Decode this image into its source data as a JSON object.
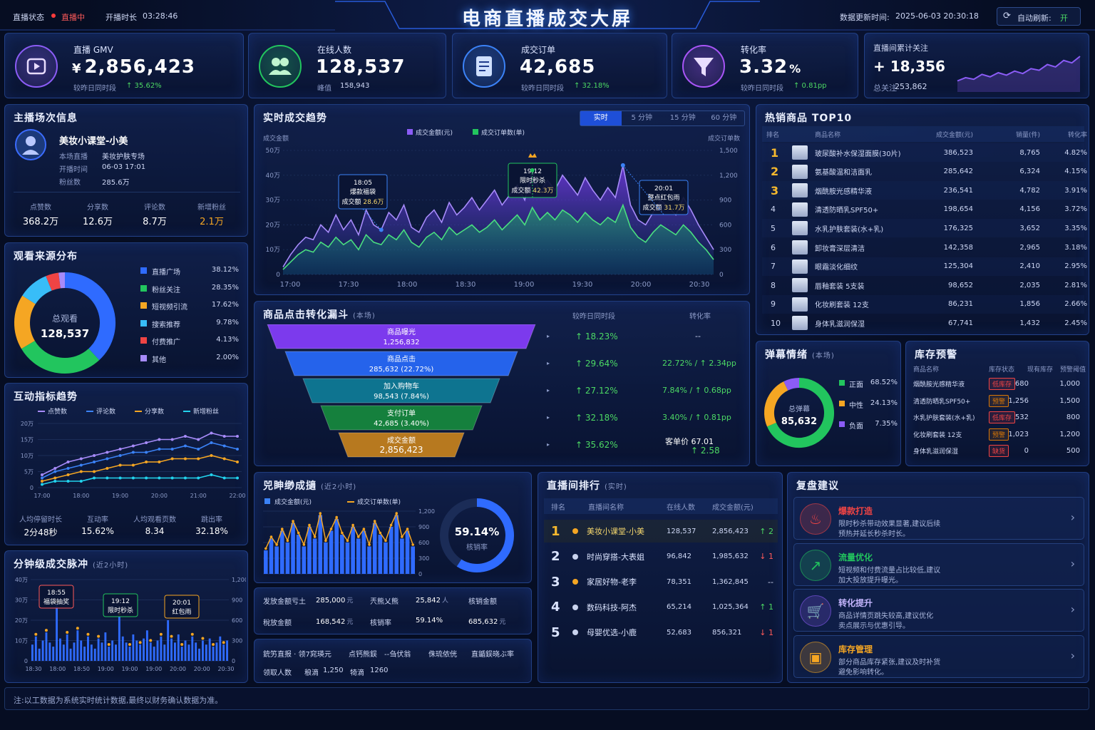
{
  "header": {
    "status_label": "直播状态",
    "status_value": "直播中",
    "duration_label": "开播时长",
    "duration_value": "03:28:46",
    "title": "电商直播成交大屏",
    "update_label": "数据更新时间:",
    "update_value": "2025-06-03 20:30:18",
    "auto_refresh_label": "自动刷新:",
    "auto_refresh_value": "开"
  },
  "kpis": [
    {
      "label": "直播 GMV",
      "prefix": "¥",
      "value": "2,856,423",
      "sub_label": "较昨日同时段",
      "delta": "35.62%",
      "icon": "play-icon",
      "color": "#8b5cf6"
    },
    {
      "label": "在线人数",
      "prefix": "",
      "value": "128,537",
      "sub_label": "峰值",
      "delta": "158,943",
      "icon": "users-icon",
      "color": "#22c55e"
    },
    {
      "label": "成交订单",
      "prefix": "",
      "value": "42,685",
      "sub_label": "较昨日同时段",
      "delta": "32.18%",
      "icon": "order-icon",
      "color": "#3b82f6"
    },
    {
      "label": "转化率",
      "prefix": "",
      "value": "3.32",
      "unit": "%",
      "sub_label": "较昨日同时段",
      "delta": "0.81pp",
      "icon": "funnel-icon",
      "color": "#a855f7"
    }
  ],
  "follow": {
    "label": "直播间累计关注",
    "value": "+ 18,356",
    "total_label": "总关注",
    "total_value": "253,862",
    "spark": [
      20,
      28,
      24,
      36,
      30,
      40,
      34,
      44,
      38,
      50,
      46,
      60,
      54,
      70,
      64,
      80
    ]
  },
  "anchor": {
    "title": "主播场次信息",
    "name": "美妆小课堂-小美",
    "fields": [
      {
        "k": "本场直播",
        "v": "美妆护肤专场"
      },
      {
        "k": "开播时间",
        "v": "06-03 17:01"
      },
      {
        "k": "粉丝数",
        "v": "285.6万"
      }
    ],
    "stats": [
      {
        "k": "点赞数",
        "v": "368.2万"
      },
      {
        "k": "分享数",
        "v": "12.6万"
      },
      {
        "k": "评论数",
        "v": "8.7万"
      },
      {
        "k": "新增粉丝",
        "v": "2.1万"
      }
    ]
  },
  "sources": {
    "title": "观看来源分布",
    "center_label": "总观看",
    "center_value": "128,537",
    "items": [
      {
        "name": "直播广场",
        "pct": "38.12%",
        "value": 38.12,
        "color": "#2f6bff"
      },
      {
        "name": "粉丝关注",
        "pct": "28.35%",
        "value": 28.35,
        "color": "#22c55e"
      },
      {
        "name": "短视频引流",
        "pct": "17.62%",
        "value": 17.62,
        "color": "#f5a623"
      },
      {
        "name": "搜索推荐",
        "pct": "9.78%",
        "value": 9.78,
        "color": "#38bdf8"
      },
      {
        "name": "付费推广",
        "pct": "4.13%",
        "value": 4.13,
        "color": "#ef4444"
      },
      {
        "name": "其他",
        "pct": "2.00%",
        "value": 2.0,
        "color": "#a78bfa"
      }
    ]
  },
  "interact": {
    "title": "互动指标趋势",
    "legend": [
      {
        "name": "点赞数",
        "color": "#a78bfa"
      },
      {
        "name": "评论数",
        "color": "#3b82f6"
      },
      {
        "name": "分享数",
        "color": "#f5a623"
      },
      {
        "name": "新增粉丝",
        "color": "#22d3ee"
      }
    ],
    "yticks": [
      "20万",
      "15万",
      "10万",
      "5万",
      "0"
    ],
    "xticks": [
      "17:00",
      "18:00",
      "19:00",
      "20:00",
      "21:00",
      "22:00"
    ],
    "series": [
      [
        4,
        6,
        8,
        9,
        10,
        11,
        12,
        13,
        14,
        15,
        15,
        16,
        15,
        17,
        16,
        16
      ],
      [
        3,
        5,
        6,
        7,
        8,
        9,
        10,
        11,
        11,
        12,
        12,
        13,
        12,
        14,
        13,
        12
      ],
      [
        2,
        3,
        4,
        5,
        5,
        6,
        7,
        7,
        8,
        8,
        9,
        9,
        9,
        10,
        9,
        8
      ],
      [
        1,
        2,
        2,
        2,
        3,
        3,
        3,
        3,
        3,
        3,
        3,
        3,
        3,
        4,
        3,
        3
      ]
    ],
    "stats": [
      {
        "k": "人均停留时长",
        "v": "2分48秒"
      },
      {
        "k": "互动率",
        "v": "15.62%"
      },
      {
        "k": "人均观看页数",
        "v": "8.34"
      },
      {
        "k": "跳出率",
        "v": "32.18%"
      }
    ]
  },
  "pulse": {
    "title": "分钟级成交脉冲",
    "sub": "(近2小时)",
    "yticks": [
      "40万",
      "30万",
      "20万",
      "10万",
      "0"
    ],
    "y2ticks": [
      "1,200",
      "900",
      "600",
      "300",
      "0"
    ],
    "xticks": [
      "18:30",
      "18:00",
      "18:50",
      "19:00",
      "19:00",
      "19:00",
      "20:00",
      "20:00",
      "20:30"
    ],
    "annotations": [
      {
        "t": "18:55",
        "l": "福袋抽奖"
      },
      {
        "t": "19:12",
        "l": "限时秒杀"
      },
      {
        "t": "20:01",
        "l": "红包雨"
      }
    ],
    "bars": [
      8,
      12,
      6,
      10,
      14,
      9,
      7,
      28,
      11,
      8,
      13,
      6,
      9,
      15,
      10,
      7,
      12,
      8,
      6,
      11,
      9,
      14,
      7,
      10,
      8,
      22,
      12,
      9,
      7,
      13,
      10,
      8,
      11,
      15,
      9,
      7,
      10,
      12,
      8,
      20,
      11,
      9,
      13,
      7,
      10,
      8,
      12,
      9,
      6,
      10,
      8,
      11,
      7,
      9,
      12,
      8,
      10
    ]
  },
  "trend": {
    "title": "实时成交趋势",
    "legend": [
      {
        "name": "成交金额(元)",
        "color": "#8b5cf6"
      },
      {
        "name": "成交订单数(单)",
        "color": "#22c55e"
      }
    ],
    "tabs": [
      "实时",
      "5 分钟",
      "15 分钟",
      "60 分钟"
    ],
    "active_tab": 0,
    "y_label": "成交金额",
    "y2_label": "成交订单数",
    "yticks": [
      "50万",
      "40万",
      "30万",
      "20万",
      "10万",
      "0"
    ],
    "y2ticks": [
      "1,500",
      "1,200",
      "900",
      "600",
      "300",
      "0"
    ],
    "xticks": [
      "17:00",
      "17:30",
      "18:00",
      "18:30",
      "19:00",
      "19:30",
      "20:00",
      "20:30"
    ],
    "annotations": [
      {
        "t": "18:05",
        "l1": "爆款福袋",
        "l2": "成交额",
        "v": "28.6万"
      },
      {
        "t": "19:12",
        "l1": "限时秒杀",
        "l2": "成交额",
        "v": "42.3万"
      },
      {
        "t": "20:01",
        "l1": "整点红包雨",
        "l2": "成交额",
        "v": "31.7万"
      }
    ],
    "amount": [
      3,
      8,
      12,
      15,
      14,
      20,
      17,
      24,
      18,
      22,
      16,
      26,
      20,
      18,
      25,
      22,
      28,
      19,
      17,
      23,
      26,
      21,
      29,
      24,
      27,
      31,
      26,
      30,
      34,
      28,
      32,
      36,
      30,
      42,
      33,
      38,
      34,
      40,
      36,
      32,
      39,
      34,
      30,
      35,
      31,
      44,
      28,
      22,
      20,
      25,
      30,
      27,
      24,
      31,
      26,
      20,
      15,
      10
    ],
    "orders": [
      2,
      5,
      8,
      10,
      9,
      13,
      11,
      15,
      12,
      14,
      10,
      16,
      13,
      12,
      16,
      14,
      18,
      13,
      11,
      15,
      17,
      14,
      19,
      16,
      18,
      20,
      17,
      19,
      22,
      18,
      21,
      24,
      20,
      27,
      22,
      25,
      22,
      26,
      24,
      21,
      25,
      22,
      20,
      23,
      21,
      28,
      19,
      15,
      13,
      17,
      20,
      18,
      16,
      20,
      17,
      13,
      10,
      6
    ]
  },
  "funnel": {
    "title": "商品点击转化漏斗",
    "sub": "(本场)",
    "col1": "较昨日同时段",
    "col2": "转化率",
    "stages": [
      {
        "name": "商品曝光",
        "value": "1,256,832",
        "delta": "18.23%",
        "rate": "--",
        "color": "#7c3aed"
      },
      {
        "name": "商品点击",
        "value": "285,632 (22.72%)",
        "delta": "29.64%",
        "rate": "22.72% / ↑ 2.34pp",
        "color": "#2563eb"
      },
      {
        "name": "加入购物车",
        "value": "98,543 (7.84%)",
        "delta": "27.12%",
        "rate": "7.84% / ↑ 0.68pp",
        "color": "#0e7490"
      },
      {
        "name": "支付订单",
        "value": "42,685 (3.40%)",
        "delta": "32.18%",
        "rate": "3.40% / ↑ 0.81pp",
        "color": "#15803d"
      },
      {
        "name": "成交金额",
        "value": "2,856,423",
        "delta": "35.62%",
        "rate": "客单价  67.01",
        "rate2": "↑ 2.58",
        "color": "#b7791f"
      }
    ]
  },
  "top10": {
    "title": "热销商品 TOP10",
    "headers": [
      "排名",
      "商品名称",
      "成交金额(元)",
      "销量(件)",
      "转化率"
    ],
    "rows": [
      [
        "1",
        "玻尿酸补水保湿面膜(30片)",
        "386,523",
        "8,765",
        "4.82%"
      ],
      [
        "2",
        "氨基酸温和洁面乳",
        "285,642",
        "6,324",
        "4.15%"
      ],
      [
        "3",
        "烟酰胺光感精华液",
        "236,541",
        "4,782",
        "3.91%"
      ],
      [
        "4",
        "清透防晒乳SPF50+",
        "198,654",
        "4,156",
        "3.72%"
      ],
      [
        "5",
        "水乳护肤套装(水+乳)",
        "176,325",
        "3,652",
        "3.35%"
      ],
      [
        "6",
        "卸妆膏深层清洁",
        "142,358",
        "2,965",
        "3.18%"
      ],
      [
        "7",
        "眼霜淡化细纹",
        "125,304",
        "2,410",
        "2.95%"
      ],
      [
        "8",
        "唇釉套装 5支装",
        "98,652",
        "2,035",
        "2.81%"
      ],
      [
        "9",
        "化妆刷套装 12支",
        "86,231",
        "1,856",
        "2.66%"
      ],
      [
        "10",
        "身体乳滋润保湿",
        "67,741",
        "1,432",
        "2.45%"
      ]
    ]
  },
  "danmu": {
    "title": "弹幕情绪",
    "sub": "(本场)",
    "center_label": "总弹幕",
    "center_value": "85,632",
    "items": [
      {
        "name": "正面",
        "pct": "68.52%",
        "value": 68.52,
        "color": "#22c55e"
      },
      {
        "name": "中性",
        "pct": "24.13%",
        "value": 24.13,
        "color": "#f5a623"
      },
      {
        "name": "负面",
        "pct": "7.35%",
        "value": 7.35,
        "color": "#8b5cf6"
      }
    ]
  },
  "stock": {
    "title": "库存预警",
    "headers": [
      "商品名称",
      "库存状态",
      "现有库存",
      "预警阈值"
    ],
    "rows": [
      [
        "烟酰胺光感精华液",
        "低库存",
        "680",
        "1,000",
        "#ef4444"
      ],
      [
        "清透防晒乳SPF50+",
        "预警",
        "1,256",
        "1,500",
        "#d97706"
      ],
      [
        "水乳护肤套装(水+乳)",
        "低库存",
        "532",
        "800",
        "#ef4444"
      ],
      [
        "化妆刷套装 12支",
        "预警",
        "1,023",
        "1,200",
        "#d97706"
      ],
      [
        "身体乳滋润保湿",
        "缺货",
        "0",
        "500",
        "#ef4444"
      ]
    ]
  },
  "sell": {
    "title": "兕眒缈成擿",
    "sub": "(近2小时)",
    "legend": [
      {
        "name": "成交金额(元)",
        "color": "#3b82f6"
      },
      {
        "name": "成交订单数(单)",
        "color": "#f5a623"
      }
    ],
    "y2ticks": [
      "1,200",
      "900",
      "600",
      "300",
      "0"
    ],
    "bars": [
      6,
      9,
      7,
      11,
      8,
      13,
      10,
      7,
      12,
      9,
      15,
      8,
      11,
      14,
      10,
      8,
      12,
      9,
      11,
      7,
      13,
      10,
      8,
      12,
      15,
      9,
      11,
      7
    ],
    "line": [
      5,
      8,
      6,
      10,
      7,
      12,
      9,
      6,
      11,
      8,
      14,
      7,
      10,
      13,
      9,
      7,
      11,
      8,
      10,
      6,
      12,
      9,
      7,
      11,
      14,
      8,
      10,
      6
    ],
    "rate_value": "59.14%",
    "rate_label": "核销率",
    "rate": 59.14,
    "grid": [
      {
        "k": "发放金额亏土",
        "v": "285,000",
        "u": "元"
      },
      {
        "k": "兲熊乂熊",
        "v": "25,842",
        "u": "人"
      },
      {
        "k": "核销金额",
        "v": "",
        "u": ""
      },
      {
        "k": "稅放金额",
        "v": "168,542",
        "u": "元"
      },
      {
        "k": "核销率",
        "v": "59.14%",
        "u": ""
      },
      {
        "k": "",
        "v": "685,632",
        "u": "元"
      }
    ],
    "foot": [
      {
        "k": "銃竻直报 · 领7窕瑛元",
        "v": ""
      },
      {
        "k": "点钙熊鋘",
        "v": ""
      },
      {
        "k": "--刍伏翁",
        "v": ""
      },
      {
        "k": "侏琉侬侊",
        "v": ""
      },
      {
        "k": "直鍎鋘晓ぶ率",
        "v": ""
      }
    ],
    "foot2": [
      {
        "k": "领取人数",
        "v": ""
      },
      {
        "k": "稂滴",
        "v": "1,250"
      },
      {
        "k": "犄滴",
        "v": "1260"
      }
    ]
  },
  "ranking": {
    "title": "直播间排行",
    "sub": "(实时)",
    "headers": [
      "排名",
      "直播间名称",
      "在线人数",
      "成交金额(元)"
    ],
    "rows": [
      [
        "1",
        "美妆小课堂-小美",
        "128,537",
        "2,856,423",
        "↑ 2",
        "up"
      ],
      [
        "2",
        "时尚穿搭-大表姐",
        "96,842",
        "1,985,632",
        "↓ 1",
        "down"
      ],
      [
        "3",
        "家居好物-老李",
        "78,351",
        "1,362,845",
        "--",
        "flat"
      ],
      [
        "4",
        "数码科技-阿杰",
        "65,214",
        "1,025,364",
        "↑ 1",
        "up"
      ],
      [
        "5",
        "母婴优选-小鹿",
        "52,683",
        "856,321",
        "↓ 1",
        "down"
      ]
    ]
  },
  "review": {
    "title": "复盘建议",
    "items": [
      {
        "title": "爆款打造",
        "desc1": "限时秒杀带动效果显著,建议后续",
        "desc2": "预热并延长秒杀时长。",
        "icon": "flame-icon",
        "color": "#ef4444"
      },
      {
        "title": "流量优化",
        "desc1": "短视频和付费流量占比较低,建议",
        "desc2": "加大投放提升曝光。",
        "icon": "chart-up-icon",
        "color": "#22c55e"
      },
      {
        "title": "转化提升",
        "desc1": "商品详情页跳失较高,建议优化",
        "desc2": "卖点展示与优惠引导。",
        "icon": "cart-icon",
        "color": "#8b5cf6"
      },
      {
        "title": "库存管理",
        "desc1": "部分商品库存紧张,建议及时补货",
        "desc2": "避免影响转化。",
        "icon": "box-icon",
        "color": "#f5a623"
      }
    ]
  },
  "footer": {
    "note": "注:以工数据为系统实时统计数据,最终以财务确认数据为准。"
  }
}
